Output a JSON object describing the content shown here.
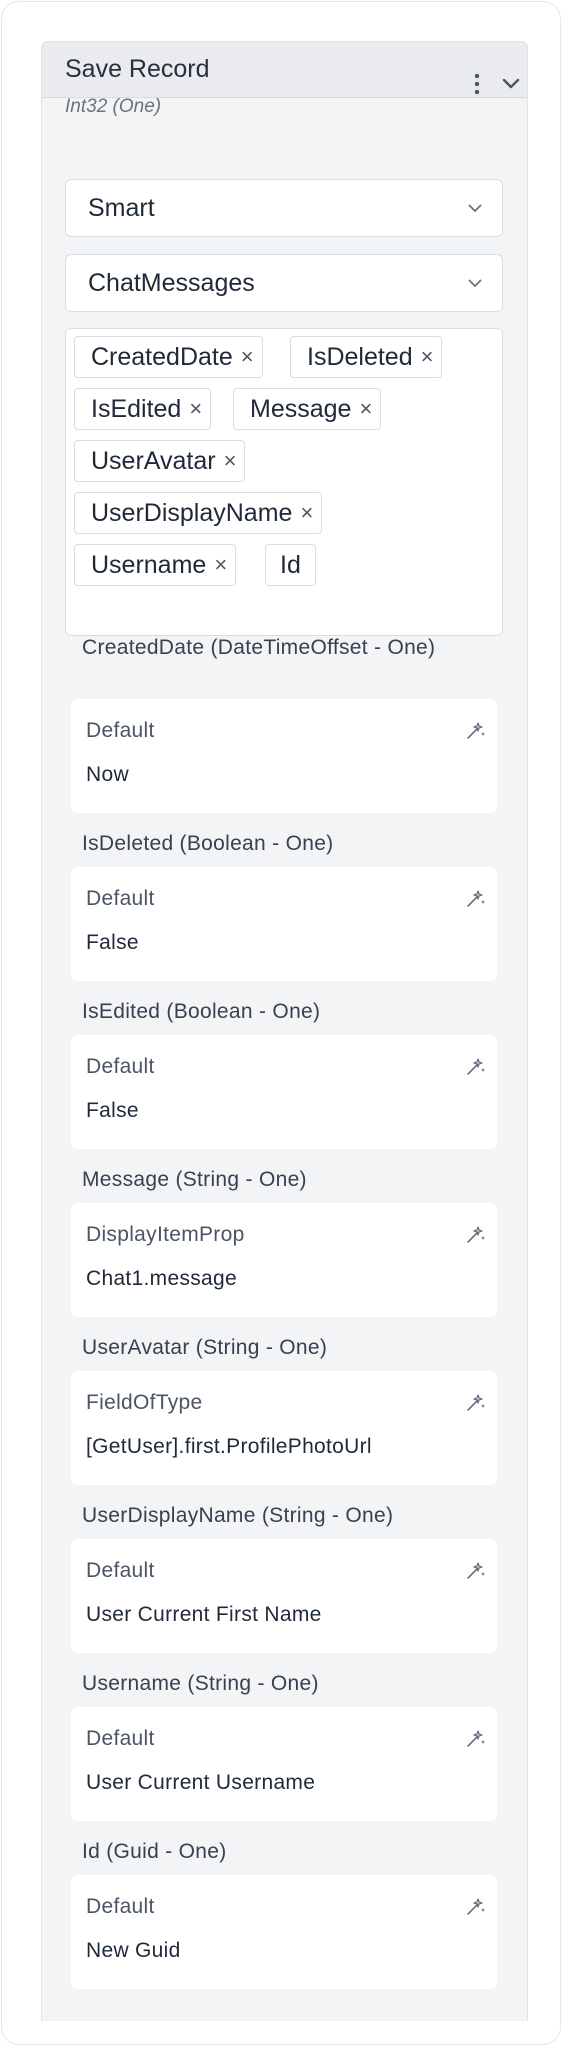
{
  "node": {
    "title": "Save Record",
    "subtitle": "Int32 (One)"
  },
  "selects": {
    "mode": "Smart",
    "table": "ChatMessages"
  },
  "tags": [
    {
      "label": "CreatedDate",
      "removable": true
    },
    {
      "label": "IsDeleted",
      "removable": true
    },
    {
      "label": "IsEdited",
      "removable": true
    },
    {
      "label": "Message",
      "removable": true
    },
    {
      "label": "UserAvatar",
      "removable": true
    },
    {
      "label": "UserDisplayName",
      "removable": true
    },
    {
      "label": "Username",
      "removable": true
    },
    {
      "label": "Id",
      "removable": false
    }
  ],
  "tag_remove_glyph": "×",
  "fields": [
    {
      "label": "CreatedDate (DateTimeOffset - One)",
      "type": "Default",
      "value": "Now"
    },
    {
      "label": "IsDeleted (Boolean - One)",
      "type": "Default",
      "value": "False"
    },
    {
      "label": "IsEdited (Boolean - One)",
      "type": "Default",
      "value": "False"
    },
    {
      "label": "Message (String - One)",
      "type": "DisplayItemProp",
      "value": "Chat1.message"
    },
    {
      "label": "UserAvatar (String - One)",
      "type": "FieldOfType",
      "value": "[GetUser].first.ProfilePhotoUrl"
    },
    {
      "label": "UserDisplayName (String - One)",
      "type": "Default",
      "value": "User Current First Name"
    },
    {
      "label": "Username (String - One)",
      "type": "Default",
      "value": "User Current Username"
    },
    {
      "label": "Id (Guid - One)",
      "type": "Default",
      "value": "New Guid"
    }
  ],
  "icons": {
    "more": "kebab-menu-icon",
    "collapse": "chevron-down-icon",
    "dropdown": "chevron-down-icon",
    "edit": "magic-wand-icon"
  },
  "colors": {
    "panel_bg": "#f3f4f6",
    "header_bg": "#e9ebef",
    "card_bg": "#ffffff",
    "border": "#d8dce3"
  }
}
